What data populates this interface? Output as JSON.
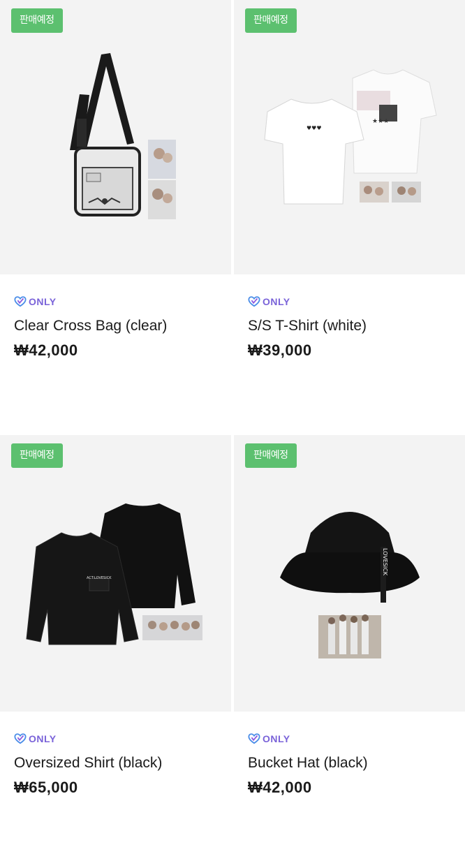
{
  "badge_label": "판매예정",
  "only_label": "ONLY",
  "colors": {
    "badge": "#5cc06f",
    "only_text": "#7a63d9",
    "thumb_bg": "#f3f3f3"
  },
  "products": [
    {
      "name": "Clear Cross Bag (clear)",
      "price": "₩42,000",
      "image_icon": "cross-bag-image"
    },
    {
      "name": "S/S T-Shirt (white)",
      "price": "₩39,000",
      "image_icon": "tshirt-image"
    },
    {
      "name": "Oversized Shirt (black)",
      "price": "₩65,000",
      "image_icon": "shirt-image"
    },
    {
      "name": "Bucket Hat (black)",
      "price": "₩42,000",
      "image_icon": "bucket-hat-image"
    }
  ]
}
